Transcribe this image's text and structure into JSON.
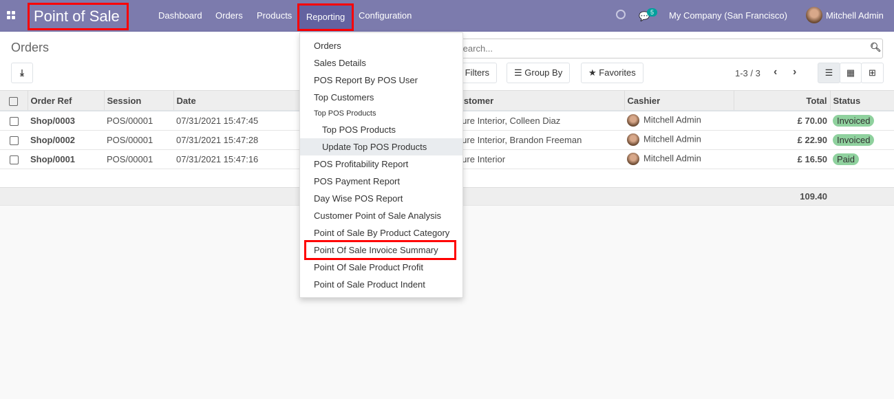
{
  "nav": {
    "app_title": "Point of Sale",
    "menus": [
      "Dashboard",
      "Orders",
      "Products",
      "Reporting",
      "Configuration"
    ],
    "message_count": "5",
    "company": "My Company (San Francisco)",
    "user": "Mitchell Admin"
  },
  "control": {
    "breadcrumb": "Orders",
    "search_placeholder": "Search...",
    "filters": "Filters",
    "group_by": "Group By",
    "favorites": "Favorites",
    "pager": "1-3 / 3"
  },
  "table": {
    "headers": [
      "Order Ref",
      "Session",
      "Date",
      "Customer",
      "Cashier",
      "Total",
      "Status"
    ],
    "rows": [
      {
        "ref": "Shop/0003",
        "session": "POS/00001",
        "date": "07/31/2021 15:47:45",
        "customer": "Azure Interior, Colleen Diaz",
        "cashier": "Mitchell Admin",
        "total": "£ 70.00",
        "status": "Invoiced"
      },
      {
        "ref": "Shop/0002",
        "session": "POS/00001",
        "date": "07/31/2021 15:47:28",
        "customer": "Azure Interior, Brandon Freeman",
        "cashier": "Mitchell Admin",
        "total": "£ 22.90",
        "status": "Invoiced"
      },
      {
        "ref": "Shop/0001",
        "session": "POS/00001",
        "date": "07/31/2021 15:47:16",
        "customer": "Azure Interior",
        "cashier": "Mitchell Admin",
        "total": "£ 16.50",
        "status": "Paid"
      }
    ],
    "sum": "109.40"
  },
  "dropdown": [
    "Orders",
    "Sales Details",
    "POS Report By POS User",
    "Top Customers",
    "Top POS Products",
    "Top POS Products",
    "Update Top POS Products",
    "POS Profitability Report",
    "POS Payment Report",
    "Day Wise POS Report",
    "Customer Point of Sale Analysis",
    "Point of Sale By Product Category",
    "Point Of Sale Invoice Summary",
    "Point Of Sale Product Profit",
    "Point of Sale Product Indent"
  ]
}
